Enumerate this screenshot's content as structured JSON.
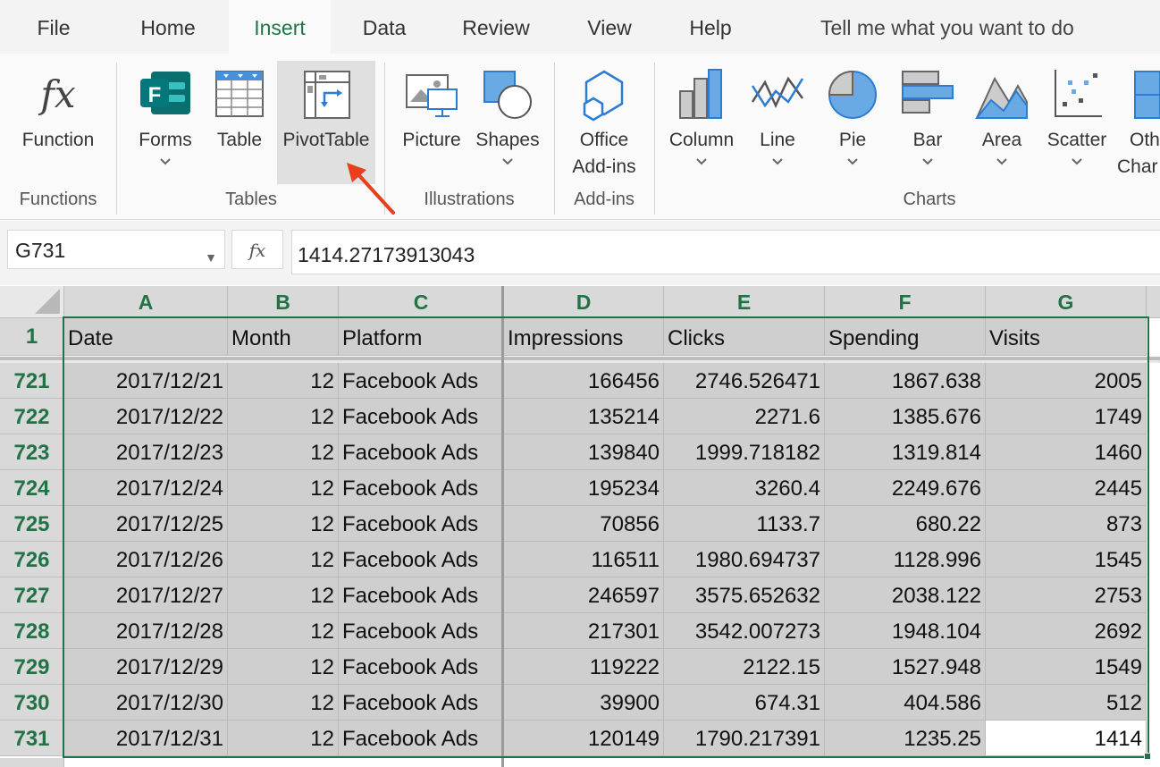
{
  "tabs": [
    {
      "label": "File",
      "active": false
    },
    {
      "label": "Home",
      "active": false
    },
    {
      "label": "Insert",
      "active": true
    },
    {
      "label": "Data",
      "active": false
    },
    {
      "label": "Review",
      "active": false
    },
    {
      "label": "View",
      "active": false
    },
    {
      "label": "Help",
      "active": false
    }
  ],
  "tell_me": "Tell me what you want to do",
  "ribbon": {
    "buttons": {
      "function": "Function",
      "forms": "Forms",
      "table": "Table",
      "pivottable": "PivotTable",
      "picture": "Picture",
      "shapes": "Shapes",
      "office_addins_line1": "Office",
      "office_addins_line2": "Add-ins",
      "column": "Column",
      "line": "Line",
      "pie": "Pie",
      "bar": "Bar",
      "area": "Area",
      "scatter": "Scatter",
      "other_line1": "Oth",
      "other_line2": "Char"
    },
    "groups": {
      "functions": "Functions",
      "tables": "Tables",
      "illustrations": "Illustrations",
      "addins": "Add-ins",
      "charts": "Charts"
    },
    "icons": {
      "function": "fx-icon",
      "forms": "forms-icon",
      "table": "table-icon",
      "pivottable": "pivottable-icon",
      "picture": "picture-icon",
      "shapes": "shapes-icon",
      "office_addins": "addins-icon",
      "column": "column-chart-icon",
      "line": "line-chart-icon",
      "pie": "pie-chart-icon",
      "bar": "bar-chart-icon",
      "area": "area-chart-icon",
      "scatter": "scatter-chart-icon",
      "other": "other-charts-icon"
    }
  },
  "formula_bar": {
    "name_box": "G731",
    "fx_label": "fx",
    "value": "1414.27173913043"
  },
  "colors": {
    "accent": "#217346",
    "arrow": "#e8401c",
    "selection_fill": "#cfcfcf"
  },
  "sheet": {
    "columns": [
      "A",
      "B",
      "C",
      "D",
      "E",
      "F",
      "G"
    ],
    "header_row": {
      "row": "1",
      "cells": [
        "Date",
        "Month",
        "Platform",
        "Impressions",
        "Clicks",
        "Spending",
        "Visits"
      ]
    },
    "rows": [
      {
        "row": "721",
        "cells": [
          "2017/12/21",
          "12",
          "Facebook Ads",
          "166456",
          "2746.526471",
          "1867.638",
          "2005"
        ]
      },
      {
        "row": "722",
        "cells": [
          "2017/12/22",
          "12",
          "Facebook Ads",
          "135214",
          "2271.6",
          "1385.676",
          "1749"
        ]
      },
      {
        "row": "723",
        "cells": [
          "2017/12/23",
          "12",
          "Facebook Ads",
          "139840",
          "1999.718182",
          "1319.814",
          "1460"
        ]
      },
      {
        "row": "724",
        "cells": [
          "2017/12/24",
          "12",
          "Facebook Ads",
          "195234",
          "3260.4",
          "2249.676",
          "2445"
        ]
      },
      {
        "row": "725",
        "cells": [
          "2017/12/25",
          "12",
          "Facebook Ads",
          "70856",
          "1133.7",
          "680.22",
          "873"
        ]
      },
      {
        "row": "726",
        "cells": [
          "2017/12/26",
          "12",
          "Facebook Ads",
          "116511",
          "1980.694737",
          "1128.996",
          "1545"
        ]
      },
      {
        "row": "727",
        "cells": [
          "2017/12/27",
          "12",
          "Facebook Ads",
          "246597",
          "3575.652632",
          "2038.122",
          "2753"
        ]
      },
      {
        "row": "728",
        "cells": [
          "2017/12/28",
          "12",
          "Facebook Ads",
          "217301",
          "3542.007273",
          "1948.104",
          "2692"
        ]
      },
      {
        "row": "729",
        "cells": [
          "2017/12/29",
          "12",
          "Facebook Ads",
          "119222",
          "2122.15",
          "1527.948",
          "1549"
        ]
      },
      {
        "row": "730",
        "cells": [
          "2017/12/30",
          "12",
          "Facebook Ads",
          "39900",
          "674.31",
          "404.586",
          "512"
        ]
      },
      {
        "row": "731",
        "cells": [
          "2017/12/31",
          "12",
          "Facebook Ads",
          "120149",
          "1790.217391",
          "1235.25",
          "1414"
        ]
      }
    ],
    "active_cell": {
      "row": "731",
      "column": "G"
    }
  }
}
